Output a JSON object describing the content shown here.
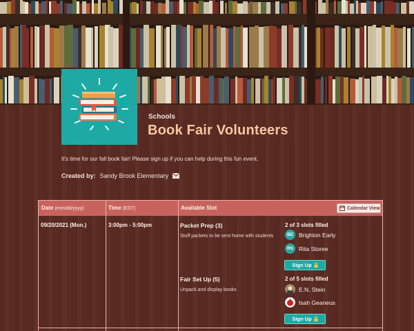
{
  "header": {
    "category": "Schools",
    "title": "Book Fair Volunteers"
  },
  "intro": {
    "text": "It's time for our fall book fair!  Please sign up if you can help during this fun event."
  },
  "created_by": {
    "label": "Created by:",
    "name": "Sandy Brook Elementary",
    "icon": "mail-icon"
  },
  "table": {
    "columns": {
      "date": "Date",
      "date_format": "(mm/dd/yyyy)",
      "time": "Time",
      "time_zone": "(EST)",
      "slot": "Available Slot"
    },
    "calendar_button": "Calendar View",
    "rows": [
      {
        "date": "09/20/2021 (Mon.)",
        "time": "3:00pm - 5:00pm",
        "slots": [
          {
            "name": "Packet Prep (3)",
            "description": "Stuff packets to be sent home with students",
            "filled": "2 of 3 slots filled",
            "volunteers": [
              {
                "initials": "BE",
                "name": "Brighton Early"
              },
              {
                "initials": "RS",
                "name": "Rita Storee"
              }
            ],
            "signup_label": "Sign Up"
          },
          {
            "name": "Fair Set Up (5)",
            "description": "Unpack and display books",
            "filled": "2 of 5 slots filled",
            "volunteers": [
              {
                "initials": "",
                "name": "E.N. Stein",
                "avatar": "photo"
              },
              {
                "initials": "",
                "name": "Isah Geaneus",
                "avatar": "apple"
              }
            ],
            "signup_label": "Sign Up"
          }
        ]
      }
    ]
  },
  "colors": {
    "background": "#5b2b23",
    "header_row": "#c8625c",
    "accent_teal": "#1fa9a5",
    "title": "#f7c8a2"
  }
}
